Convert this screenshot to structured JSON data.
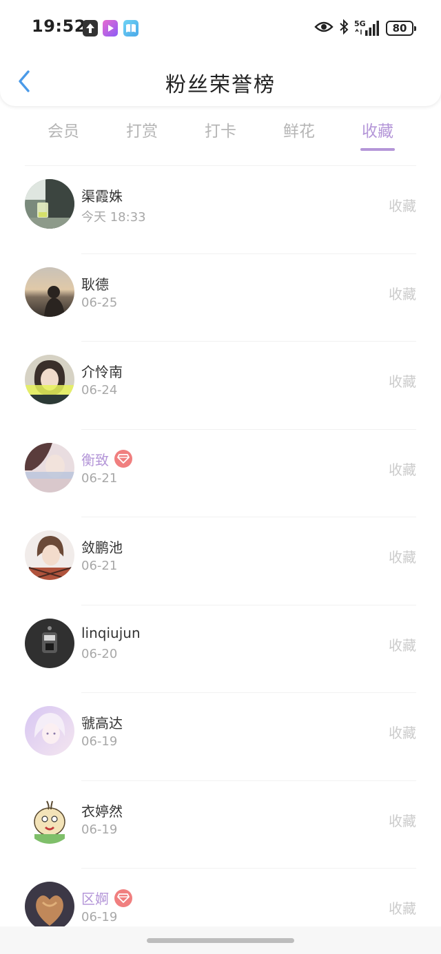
{
  "status_bar": {
    "time": "19:52",
    "network": "5G",
    "battery": "80",
    "icons": [
      "upload-icon",
      "video-app-icon",
      "book-app-icon",
      "eye-icon",
      "bluetooth-icon",
      "signal-icon",
      "battery-icon"
    ]
  },
  "header": {
    "title": "粉丝荣誉榜",
    "back_icon": "chevron-left-icon"
  },
  "tabs": [
    {
      "label": "会员",
      "active": false
    },
    {
      "label": "打赏",
      "active": false
    },
    {
      "label": "打卡",
      "active": false
    },
    {
      "label": "鲜花",
      "active": false
    },
    {
      "label": "收藏",
      "active": true
    }
  ],
  "colors": {
    "accent": "#b496d8",
    "vip_badge": "#f07f7f",
    "muted_text": "#a8a8a8",
    "action_text": "#cbcbcb"
  },
  "fans": [
    {
      "name": "渠霞姝",
      "date": "今天 18:33",
      "action": "收藏",
      "vip": false
    },
    {
      "name": "耿德",
      "date": "06-25",
      "action": "收藏",
      "vip": false
    },
    {
      "name": "介怜南",
      "date": "06-24",
      "action": "收藏",
      "vip": false
    },
    {
      "name": "衡致",
      "date": "06-21",
      "action": "收藏",
      "vip": true
    },
    {
      "name": "敛鹏池",
      "date": "06-21",
      "action": "收藏",
      "vip": false
    },
    {
      "name": "linqiujun",
      "date": "06-20",
      "action": "收藏",
      "vip": false
    },
    {
      "name": "虢高达",
      "date": "06-19",
      "action": "收藏",
      "vip": false
    },
    {
      "name": "衣婷然",
      "date": "06-19",
      "action": "收藏",
      "vip": false
    },
    {
      "name": "区婀",
      "date": "06-19",
      "action": "收藏",
      "vip": true
    }
  ]
}
